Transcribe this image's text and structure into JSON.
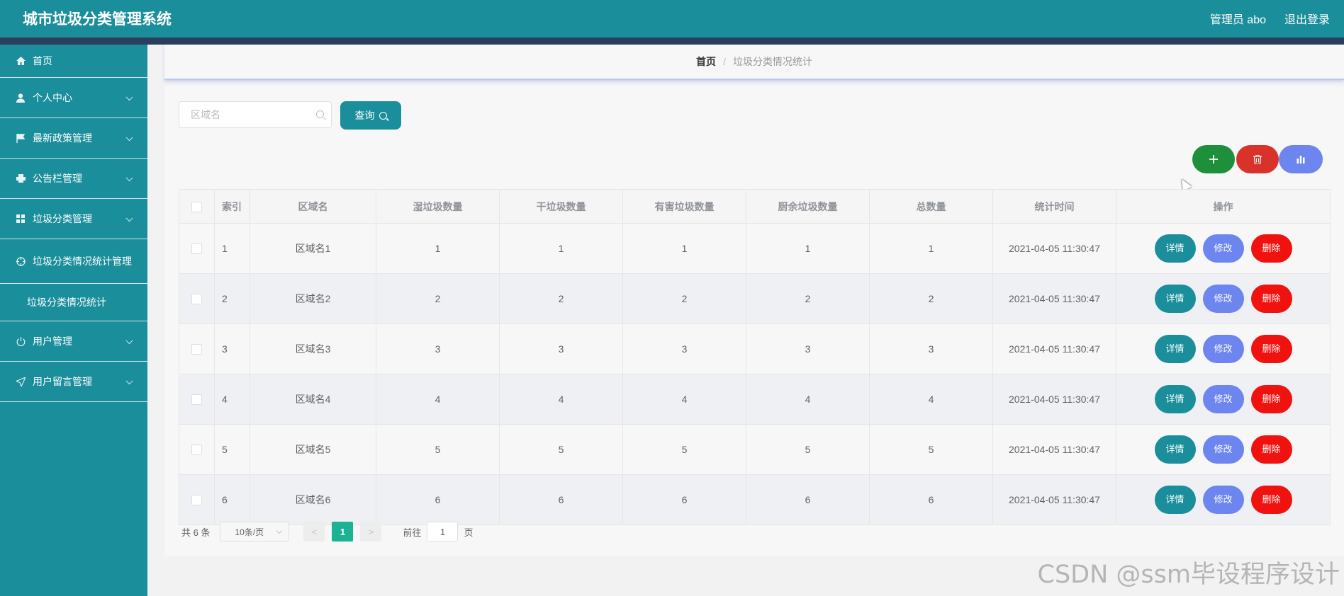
{
  "header": {
    "title": "城市垃圾分类管理系统",
    "user": "管理员 abo",
    "logout": "退出登录"
  },
  "sidebar": {
    "items": [
      {
        "label": "首页",
        "icon": "home-icon"
      },
      {
        "label": "个人中心",
        "icon": "user-icon"
      },
      {
        "label": "最新政策管理",
        "icon": "flag-icon"
      },
      {
        "label": "公告栏管理",
        "icon": "printer-icon"
      },
      {
        "label": "垃圾分类管理",
        "icon": "grid-icon"
      },
      {
        "label": "垃圾分类情况统计管理",
        "icon": "target-icon"
      },
      {
        "label": "用户管理",
        "icon": "power-icon"
      },
      {
        "label": "用户留言管理",
        "icon": "send-icon"
      }
    ],
    "sub_item": "垃圾分类情况统计"
  },
  "breadcrumb": {
    "home": "首页",
    "sep": "/",
    "current": "垃圾分类情况统计"
  },
  "search": {
    "placeholder": "区域名",
    "button": "查询"
  },
  "table": {
    "headers": [
      "索引",
      "区域名",
      "湿垃圾数量",
      "干垃圾数量",
      "有害垃圾数量",
      "厨余垃圾数量",
      "总数量",
      "统计时间",
      "操作"
    ],
    "rows": [
      {
        "idx": "1",
        "area": "区域名1",
        "wet": "1",
        "dry": "1",
        "harmful": "1",
        "kitchen": "1",
        "total": "1",
        "time": "2021-04-05 11:30:47"
      },
      {
        "idx": "2",
        "area": "区域名2",
        "wet": "2",
        "dry": "2",
        "harmful": "2",
        "kitchen": "2",
        "total": "2",
        "time": "2021-04-05 11:30:47"
      },
      {
        "idx": "3",
        "area": "区域名3",
        "wet": "3",
        "dry": "3",
        "harmful": "3",
        "kitchen": "3",
        "total": "3",
        "time": "2021-04-05 11:30:47"
      },
      {
        "idx": "4",
        "area": "区域名4",
        "wet": "4",
        "dry": "4",
        "harmful": "4",
        "kitchen": "4",
        "total": "4",
        "time": "2021-04-05 11:30:47"
      },
      {
        "idx": "5",
        "area": "区域名5",
        "wet": "5",
        "dry": "5",
        "harmful": "5",
        "kitchen": "5",
        "total": "5",
        "time": "2021-04-05 11:30:47"
      },
      {
        "idx": "6",
        "area": "区域名6",
        "wet": "6",
        "dry": "6",
        "harmful": "6",
        "kitchen": "6",
        "total": "6",
        "time": "2021-04-05 11:30:47"
      }
    ],
    "actions": {
      "detail": "详情",
      "edit": "修改",
      "delete": "删除"
    }
  },
  "toolbar": {
    "add_icon": "plus-icon",
    "delete_icon": "trash-icon",
    "chart_icon": "bar-chart-icon"
  },
  "pagination": {
    "total": "共 6 条",
    "page_size": "10条/页",
    "current_page": "1",
    "goto_prefix": "前往",
    "goto_value": "1",
    "goto_suffix": "页",
    "prev": "<",
    "next": ">"
  },
  "watermark": "CSDN @ssm毕设程序设计",
  "colors": {
    "primary": "#1b8e9b",
    "header_bar": "#2b3f5c",
    "add": "#1e8f3a",
    "delete": "#d8322b",
    "edit": "#6c85ef",
    "danger": "#f0120f",
    "active_page": "#1bb394"
  }
}
